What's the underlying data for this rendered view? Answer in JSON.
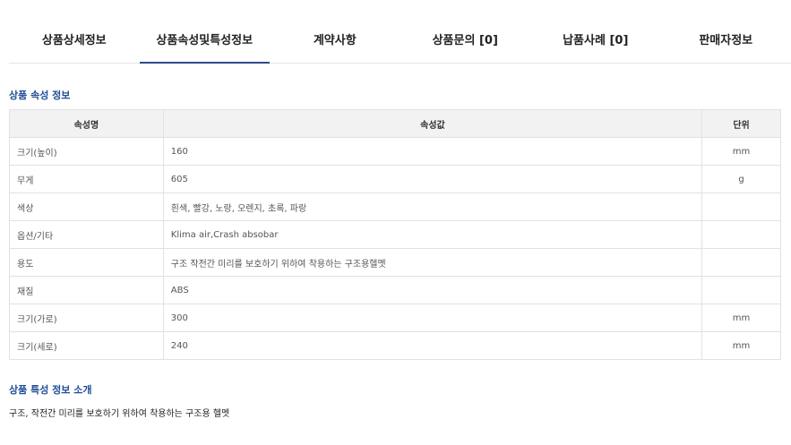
{
  "tabs": [
    {
      "label": "상품상세정보"
    },
    {
      "label": "상품속성및특성정보"
    },
    {
      "label": "계약사항"
    },
    {
      "label": "상품문의 [0]"
    },
    {
      "label": "납품사례 [0]"
    },
    {
      "label": "판매자정보"
    }
  ],
  "active_tab_index": 1,
  "attributes": {
    "title": "상품 속성 정보",
    "headers": {
      "name": "속성명",
      "value": "속성값",
      "unit": "단위"
    },
    "rows": [
      {
        "name": "크기(높이)",
        "value": "160",
        "unit": "mm"
      },
      {
        "name": "무게",
        "value": "605",
        "unit": "g"
      },
      {
        "name": "색상",
        "value": "흰색, 빨강, 노랑, 오렌지, 초록, 파랑",
        "unit": ""
      },
      {
        "name": "옵션/기타",
        "value": "Klima air,Crash absobar",
        "unit": ""
      },
      {
        "name": "용도",
        "value": "구조 작전간 미리를 보호하기 위하여 착용하는 구조용헬멧",
        "unit": ""
      },
      {
        "name": "재질",
        "value": "ABS",
        "unit": ""
      },
      {
        "name": "크기(가로)",
        "value": "300",
        "unit": "mm"
      },
      {
        "name": "크기(세로)",
        "value": "240",
        "unit": "mm"
      }
    ]
  },
  "features": {
    "title": "상품 특성 정보 소개",
    "text": "구조, 작전간 미리를 보호하기 위하여 착용하는 구조용 헬멧"
  },
  "colors": {
    "accent": "#1f4e96",
    "active_tab_underline": "#2e4a8c",
    "table_header_bg": "#f2f2f2",
    "border": "#e1e1e1"
  }
}
